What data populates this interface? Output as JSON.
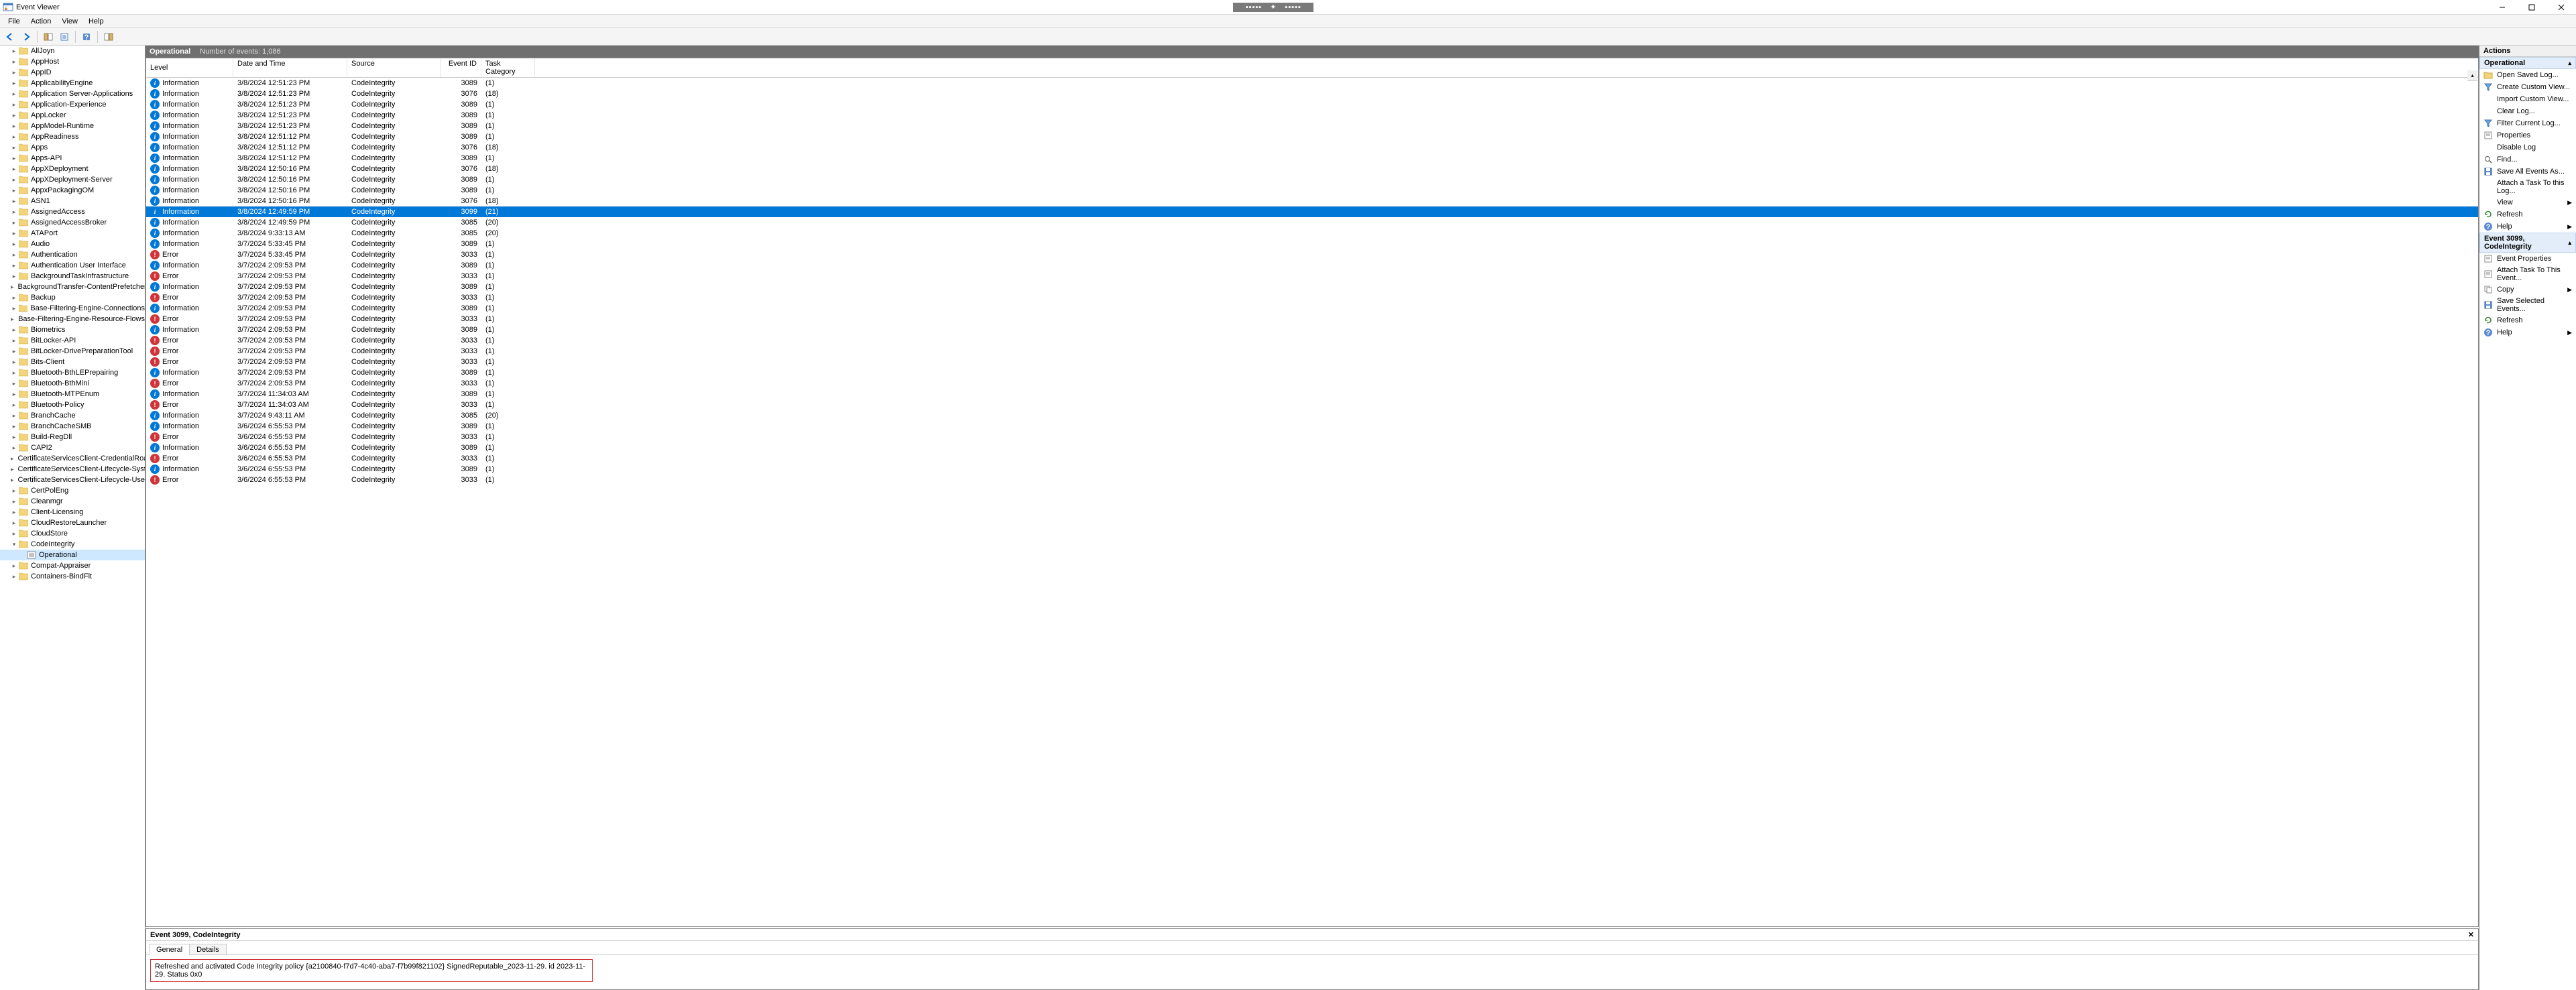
{
  "window": {
    "title": "Event Viewer"
  },
  "menu": {
    "items": [
      "File",
      "Action",
      "View",
      "Help"
    ]
  },
  "tree": {
    "items": [
      {
        "label": "AllJoyn",
        "expand": ">"
      },
      {
        "label": "AppHost",
        "expand": ">"
      },
      {
        "label": "AppID",
        "expand": ">"
      },
      {
        "label": "ApplicabilityEngine",
        "expand": ">"
      },
      {
        "label": "Application Server-Applications",
        "expand": ">"
      },
      {
        "label": "Application-Experience",
        "expand": ">"
      },
      {
        "label": "AppLocker",
        "expand": ">"
      },
      {
        "label": "AppModel-Runtime",
        "expand": ">"
      },
      {
        "label": "AppReadiness",
        "expand": ">"
      },
      {
        "label": "Apps",
        "expand": ">"
      },
      {
        "label": "Apps-API",
        "expand": ">"
      },
      {
        "label": "AppXDeployment",
        "expand": ">"
      },
      {
        "label": "AppXDeployment-Server",
        "expand": ">"
      },
      {
        "label": "AppxPackagingOM",
        "expand": ">"
      },
      {
        "label": "ASN1",
        "expand": ">"
      },
      {
        "label": "AssignedAccess",
        "expand": ">"
      },
      {
        "label": "AssignedAccessBroker",
        "expand": ">"
      },
      {
        "label": "ATAPort",
        "expand": ">"
      },
      {
        "label": "Audio",
        "expand": ">"
      },
      {
        "label": "Authentication",
        "expand": ">"
      },
      {
        "label": "Authentication User Interface",
        "expand": ">"
      },
      {
        "label": "BackgroundTaskInfrastructure",
        "expand": ">"
      },
      {
        "label": "BackgroundTransfer-ContentPrefetcher",
        "expand": ">"
      },
      {
        "label": "Backup",
        "expand": ">"
      },
      {
        "label": "Base-Filtering-Engine-Connections",
        "expand": ">"
      },
      {
        "label": "Base-Filtering-Engine-Resource-Flows",
        "expand": ">"
      },
      {
        "label": "Biometrics",
        "expand": ">"
      },
      {
        "label": "BitLocker-API",
        "expand": ">"
      },
      {
        "label": "BitLocker-DrivePreparationTool",
        "expand": ">"
      },
      {
        "label": "Bits-Client",
        "expand": ">"
      },
      {
        "label": "Bluetooth-BthLEPrepairing",
        "expand": ">"
      },
      {
        "label": "Bluetooth-BthMini",
        "expand": ">"
      },
      {
        "label": "Bluetooth-MTPEnum",
        "expand": ">"
      },
      {
        "label": "Bluetooth-Policy",
        "expand": ">"
      },
      {
        "label": "BranchCache",
        "expand": ">"
      },
      {
        "label": "BranchCacheSMB",
        "expand": ">"
      },
      {
        "label": "Build-RegDll",
        "expand": ">"
      },
      {
        "label": "CAPI2",
        "expand": ">"
      },
      {
        "label": "CertificateServicesClient-CredentialRoaming",
        "expand": ">"
      },
      {
        "label": "CertificateServicesClient-Lifecycle-System",
        "expand": ">"
      },
      {
        "label": "CertificateServicesClient-Lifecycle-User",
        "expand": ">"
      },
      {
        "label": "CertPolEng",
        "expand": ">"
      },
      {
        "label": "Cleanmgr",
        "expand": ">"
      },
      {
        "label": "Client-Licensing",
        "expand": ">"
      },
      {
        "label": "CloudRestoreLauncher",
        "expand": ">"
      },
      {
        "label": "CloudStore",
        "expand": ">"
      },
      {
        "label": "CodeIntegrity",
        "expand": "v",
        "expanded": true
      },
      {
        "label": "Operational",
        "selected": true,
        "child": true
      },
      {
        "label": "Compat-Appraiser",
        "expand": ">"
      },
      {
        "label": "Containers-BindFlt",
        "expand": ">"
      }
    ]
  },
  "log": {
    "name": "Operational",
    "count_label": "Number of events: 1,086"
  },
  "grid": {
    "headers": {
      "level": "Level",
      "date": "Date and Time",
      "source": "Source",
      "eventid": "Event ID",
      "cat": "Task Category"
    },
    "rows": [
      {
        "t": "info",
        "level": "Information",
        "date": "3/8/2024 12:51:23 PM",
        "src": "CodeIntegrity",
        "id": "3089",
        "cat": "(1)"
      },
      {
        "t": "info",
        "level": "Information",
        "date": "3/8/2024 12:51:23 PM",
        "src": "CodeIntegrity",
        "id": "3076",
        "cat": "(18)"
      },
      {
        "t": "info",
        "level": "Information",
        "date": "3/8/2024 12:51:23 PM",
        "src": "CodeIntegrity",
        "id": "3089",
        "cat": "(1)"
      },
      {
        "t": "info",
        "level": "Information",
        "date": "3/8/2024 12:51:23 PM",
        "src": "CodeIntegrity",
        "id": "3089",
        "cat": "(1)"
      },
      {
        "t": "info",
        "level": "Information",
        "date": "3/8/2024 12:51:23 PM",
        "src": "CodeIntegrity",
        "id": "3089",
        "cat": "(1)"
      },
      {
        "t": "info",
        "level": "Information",
        "date": "3/8/2024 12:51:12 PM",
        "src": "CodeIntegrity",
        "id": "3089",
        "cat": "(1)"
      },
      {
        "t": "info",
        "level": "Information",
        "date": "3/8/2024 12:51:12 PM",
        "src": "CodeIntegrity",
        "id": "3076",
        "cat": "(18)"
      },
      {
        "t": "info",
        "level": "Information",
        "date": "3/8/2024 12:51:12 PM",
        "src": "CodeIntegrity",
        "id": "3089",
        "cat": "(1)"
      },
      {
        "t": "info",
        "level": "Information",
        "date": "3/8/2024 12:50:16 PM",
        "src": "CodeIntegrity",
        "id": "3076",
        "cat": "(18)"
      },
      {
        "t": "info",
        "level": "Information",
        "date": "3/8/2024 12:50:16 PM",
        "src": "CodeIntegrity",
        "id": "3089",
        "cat": "(1)"
      },
      {
        "t": "info",
        "level": "Information",
        "date": "3/8/2024 12:50:16 PM",
        "src": "CodeIntegrity",
        "id": "3089",
        "cat": "(1)"
      },
      {
        "t": "info",
        "level": "Information",
        "date": "3/8/2024 12:50:16 PM",
        "src": "CodeIntegrity",
        "id": "3076",
        "cat": "(18)"
      },
      {
        "t": "info",
        "level": "Information",
        "date": "3/8/2024 12:49:59 PM",
        "src": "CodeIntegrity",
        "id": "3099",
        "cat": "(21)",
        "selected": true
      },
      {
        "t": "info",
        "level": "Information",
        "date": "3/8/2024 12:49:59 PM",
        "src": "CodeIntegrity",
        "id": "3085",
        "cat": "(20)"
      },
      {
        "t": "info",
        "level": "Information",
        "date": "3/8/2024 9:33:13 AM",
        "src": "CodeIntegrity",
        "id": "3085",
        "cat": "(20)"
      },
      {
        "t": "info",
        "level": "Information",
        "date": "3/7/2024 5:33:45 PM",
        "src": "CodeIntegrity",
        "id": "3089",
        "cat": "(1)"
      },
      {
        "t": "error",
        "level": "Error",
        "date": "3/7/2024 5:33:45 PM",
        "src": "CodeIntegrity",
        "id": "3033",
        "cat": "(1)"
      },
      {
        "t": "info",
        "level": "Information",
        "date": "3/7/2024 2:09:53 PM",
        "src": "CodeIntegrity",
        "id": "3089",
        "cat": "(1)"
      },
      {
        "t": "error",
        "level": "Error",
        "date": "3/7/2024 2:09:53 PM",
        "src": "CodeIntegrity",
        "id": "3033",
        "cat": "(1)"
      },
      {
        "t": "info",
        "level": "Information",
        "date": "3/7/2024 2:09:53 PM",
        "src": "CodeIntegrity",
        "id": "3089",
        "cat": "(1)"
      },
      {
        "t": "error",
        "level": "Error",
        "date": "3/7/2024 2:09:53 PM",
        "src": "CodeIntegrity",
        "id": "3033",
        "cat": "(1)"
      },
      {
        "t": "info",
        "level": "Information",
        "date": "3/7/2024 2:09:53 PM",
        "src": "CodeIntegrity",
        "id": "3089",
        "cat": "(1)"
      },
      {
        "t": "error",
        "level": "Error",
        "date": "3/7/2024 2:09:53 PM",
        "src": "CodeIntegrity",
        "id": "3033",
        "cat": "(1)"
      },
      {
        "t": "info",
        "level": "Information",
        "date": "3/7/2024 2:09:53 PM",
        "src": "CodeIntegrity",
        "id": "3089",
        "cat": "(1)"
      },
      {
        "t": "error",
        "level": "Error",
        "date": "3/7/2024 2:09:53 PM",
        "src": "CodeIntegrity",
        "id": "3033",
        "cat": "(1)"
      },
      {
        "t": "error",
        "level": "Error",
        "date": "3/7/2024 2:09:53 PM",
        "src": "CodeIntegrity",
        "id": "3033",
        "cat": "(1)"
      },
      {
        "t": "error",
        "level": "Error",
        "date": "3/7/2024 2:09:53 PM",
        "src": "CodeIntegrity",
        "id": "3033",
        "cat": "(1)"
      },
      {
        "t": "info",
        "level": "Information",
        "date": "3/7/2024 2:09:53 PM",
        "src": "CodeIntegrity",
        "id": "3089",
        "cat": "(1)"
      },
      {
        "t": "error",
        "level": "Error",
        "date": "3/7/2024 2:09:53 PM",
        "src": "CodeIntegrity",
        "id": "3033",
        "cat": "(1)"
      },
      {
        "t": "info",
        "level": "Information",
        "date": "3/7/2024 11:34:03 AM",
        "src": "CodeIntegrity",
        "id": "3089",
        "cat": "(1)"
      },
      {
        "t": "error",
        "level": "Error",
        "date": "3/7/2024 11:34:03 AM",
        "src": "CodeIntegrity",
        "id": "3033",
        "cat": "(1)"
      },
      {
        "t": "info",
        "level": "Information",
        "date": "3/7/2024 9:43:11 AM",
        "src": "CodeIntegrity",
        "id": "3085",
        "cat": "(20)"
      },
      {
        "t": "info",
        "level": "Information",
        "date": "3/6/2024 6:55:53 PM",
        "src": "CodeIntegrity",
        "id": "3089",
        "cat": "(1)"
      },
      {
        "t": "error",
        "level": "Error",
        "date": "3/6/2024 6:55:53 PM",
        "src": "CodeIntegrity",
        "id": "3033",
        "cat": "(1)"
      },
      {
        "t": "info",
        "level": "Information",
        "date": "3/6/2024 6:55:53 PM",
        "src": "CodeIntegrity",
        "id": "3089",
        "cat": "(1)"
      },
      {
        "t": "error",
        "level": "Error",
        "date": "3/6/2024 6:55:53 PM",
        "src": "CodeIntegrity",
        "id": "3033",
        "cat": "(1)"
      },
      {
        "t": "info",
        "level": "Information",
        "date": "3/6/2024 6:55:53 PM",
        "src": "CodeIntegrity",
        "id": "3089",
        "cat": "(1)"
      },
      {
        "t": "error",
        "level": "Error",
        "date": "3/6/2024 6:55:53 PM",
        "src": "CodeIntegrity",
        "id": "3033",
        "cat": "(1)"
      }
    ]
  },
  "detail": {
    "header": "Event 3099, CodeIntegrity",
    "tabs": {
      "general": "General",
      "details": "Details"
    },
    "message": "Refreshed and activated Code Integrity policy {a2100840-f7d7-4c40-aba7-f7b99f821102} SignedReputable_2023-11-29. id 2023-11-29. Status 0x0"
  },
  "actions": {
    "title": "Actions",
    "section1": "Operational",
    "items1": [
      {
        "label": "Open Saved Log...",
        "icon": "open"
      },
      {
        "label": "Create Custom View...",
        "icon": "funnel"
      },
      {
        "label": "Import Custom View...",
        "icon": ""
      },
      {
        "label": "Clear Log...",
        "icon": ""
      },
      {
        "label": "Filter Current Log...",
        "icon": "funnel"
      },
      {
        "label": "Properties",
        "icon": "props"
      },
      {
        "label": "Disable Log",
        "icon": ""
      },
      {
        "label": "Find...",
        "icon": "find"
      },
      {
        "label": "Save All Events As...",
        "icon": "save"
      },
      {
        "label": "Attach a Task To this Log...",
        "icon": ""
      },
      {
        "label": "View",
        "icon": "",
        "arrow": true
      },
      {
        "label": "Refresh",
        "icon": "refresh"
      },
      {
        "label": "Help",
        "icon": "help",
        "arrow": true
      }
    ],
    "section2": "Event 3099, CodeIntegrity",
    "items2": [
      {
        "label": "Event Properties",
        "icon": "props"
      },
      {
        "label": "Attach Task To This Event...",
        "icon": "props"
      },
      {
        "label": "Copy",
        "icon": "copy",
        "arrow": true
      },
      {
        "label": "Save Selected Events...",
        "icon": "save"
      },
      {
        "label": "Refresh",
        "icon": "refresh"
      },
      {
        "label": "Help",
        "icon": "help",
        "arrow": true
      }
    ]
  }
}
